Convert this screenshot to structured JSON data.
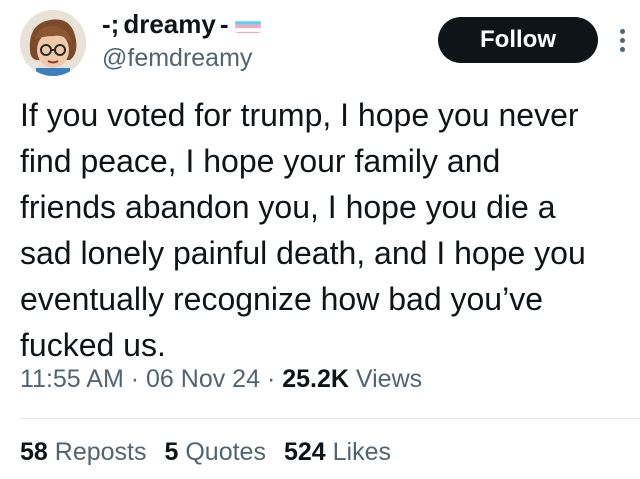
{
  "author": {
    "display_name": "⸼ dreamy ⸼",
    "display_name_prefix": "-;",
    "display_name_main": "dreamy",
    "display_name_suffix": "-",
    "handle": "@femdreamy",
    "flag_icon": "transgender-flag-icon"
  },
  "follow_button": {
    "label": "Follow"
  },
  "tweet": {
    "lines": [
      "If you voted for trump, I hope you never",
      "find peace, I hope your family and",
      "friends abandon you, I hope you die a",
      "sad lonely painful death, and I hope you",
      "eventually recognize how bad you’ve",
      "fucked us."
    ]
  },
  "meta": {
    "time": "11:55 AM",
    "date": "06 Nov 24",
    "separator": "·",
    "views_count": "25.2K",
    "views_label": "Views"
  },
  "stats": {
    "reposts_count": "58",
    "reposts_label": "Reposts",
    "quotes_count": "5",
    "quotes_label": "Quotes",
    "likes_count": "524",
    "likes_label": "Likes"
  },
  "colors": {
    "text_primary": "#0f1419",
    "text_secondary": "#536471",
    "follow_bg": "#0f1419",
    "divider": "#e6e9ec",
    "flag_blue": "#5bcefa",
    "flag_pink": "#f5a9b8",
    "flag_white": "#ffffff"
  }
}
